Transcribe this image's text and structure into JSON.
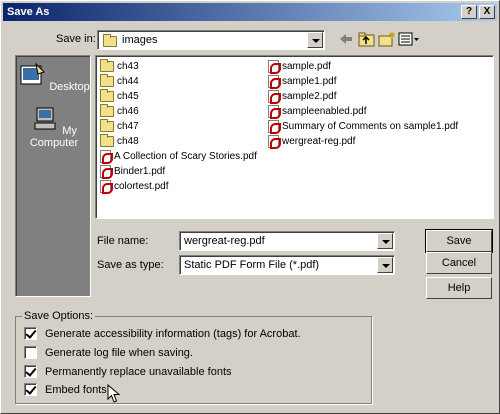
{
  "window": {
    "title": "Save As",
    "help_label": "?",
    "close_label": "X"
  },
  "save_in": {
    "label": "Save in:",
    "value": "images"
  },
  "places": [
    {
      "label": "Desktop"
    },
    {
      "label": "My Computer"
    }
  ],
  "files_col1": [
    {
      "name": "ch43",
      "type": "folder"
    },
    {
      "name": "ch44",
      "type": "folder"
    },
    {
      "name": "ch45",
      "type": "folder"
    },
    {
      "name": "ch46",
      "type": "folder"
    },
    {
      "name": "ch47",
      "type": "folder"
    },
    {
      "name": "ch48",
      "type": "folder"
    },
    {
      "name": "A Collection of Scary Stories.pdf",
      "type": "pdf"
    },
    {
      "name": "Binder1.pdf",
      "type": "pdf"
    },
    {
      "name": "colortest.pdf",
      "type": "pdf"
    }
  ],
  "files_col2": [
    {
      "name": "sample.pdf",
      "type": "pdf"
    },
    {
      "name": "sample1.pdf",
      "type": "pdf"
    },
    {
      "name": "sample2.pdf",
      "type": "pdf"
    },
    {
      "name": "sampleenabled.pdf",
      "type": "pdf"
    },
    {
      "name": "Summary of Comments on sample1.pdf",
      "type": "pdf"
    },
    {
      "name": "wergreat-reg.pdf",
      "type": "pdf"
    }
  ],
  "file_name": {
    "label": "File name:",
    "value": "wergreat-reg.pdf"
  },
  "save_type": {
    "label": "Save as type:",
    "value": "Static PDF Form File (*.pdf)"
  },
  "buttons": {
    "save": "Save",
    "cancel": "Cancel",
    "help": "Help"
  },
  "options": {
    "legend": "Save Options:",
    "items": [
      {
        "label": "Generate accessibility information (tags) for Acrobat.",
        "checked": true
      },
      {
        "label": "Generate log file when saving.",
        "checked": false
      },
      {
        "label": "Permanently replace unavailable fonts",
        "checked": true
      },
      {
        "label": "Embed fonts",
        "checked": true
      }
    ]
  }
}
